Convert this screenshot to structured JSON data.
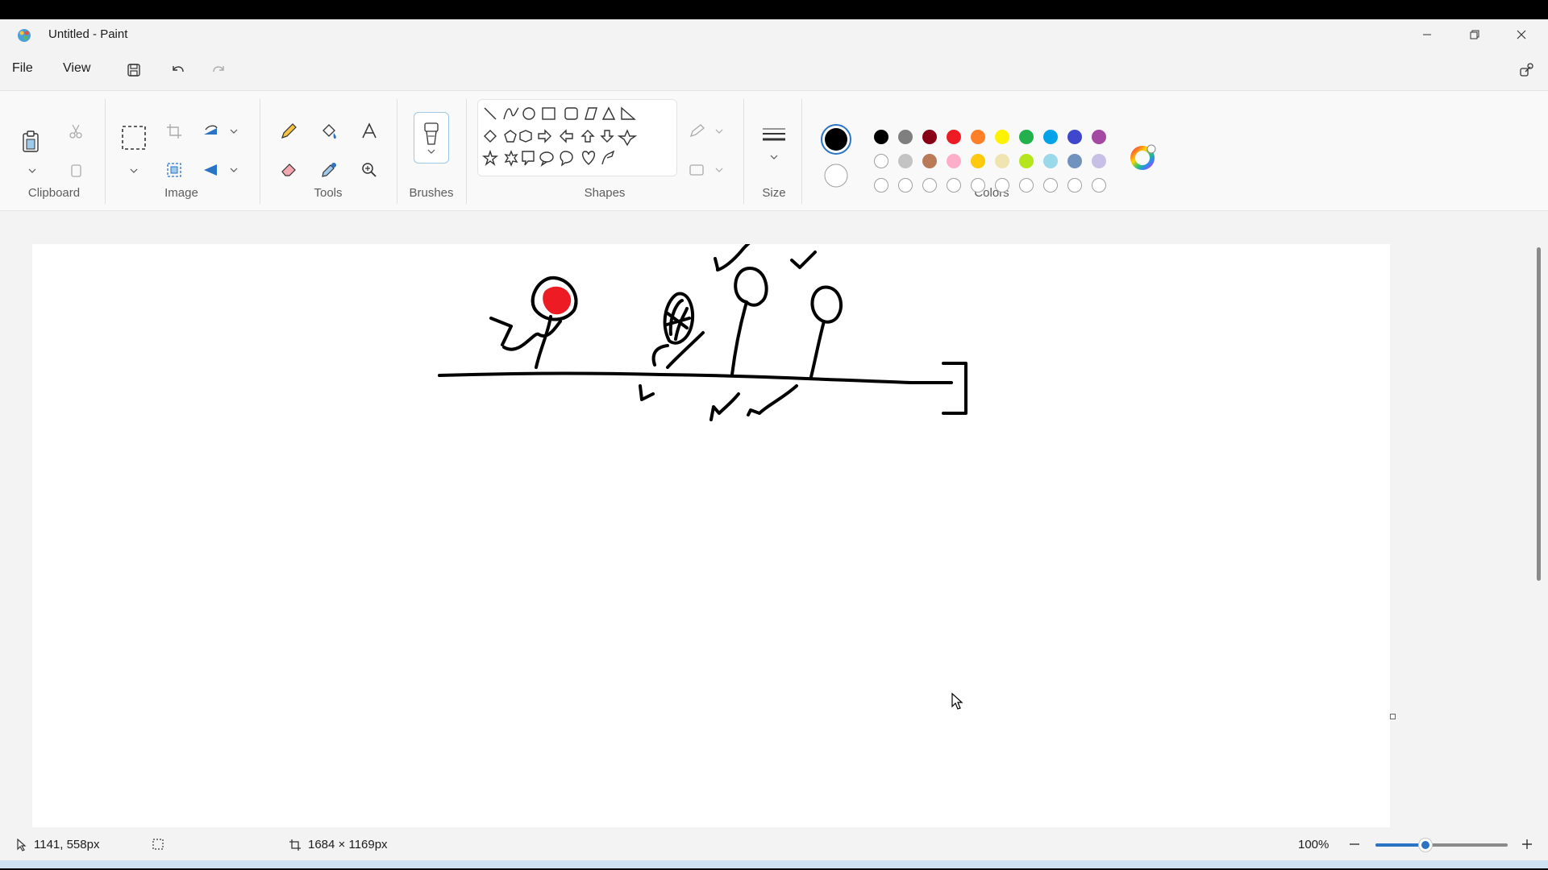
{
  "window": {
    "title": "Untitled - Paint"
  },
  "menu": {
    "file": "File",
    "view": "View"
  },
  "ribbon": {
    "groups": {
      "clipboard": "Clipboard",
      "image": "Image",
      "tools": "Tools",
      "brushes": "Brushes",
      "shapes": "Shapes",
      "size": "Size",
      "colors": "Colors"
    }
  },
  "colors": {
    "primary": "#000000",
    "secondary": "#ffffff",
    "palette_row1": [
      "#000000",
      "#7f7f7f",
      "#880015",
      "#ed1c24",
      "#ff7f27",
      "#fff200",
      "#22b14c",
      "#00a2e8",
      "#3f48cc",
      "#a349a4"
    ],
    "palette_row2": [
      "#ffffff",
      "#c3c3c3",
      "#b97a57",
      "#ffaec9",
      "#ffc90e",
      "#efe4b0",
      "#b5e61d",
      "#99d9ea",
      "#7092be",
      "#c8bfe7"
    ],
    "palette_row3_empty_count": 10
  },
  "status": {
    "cursor_position": "1141, 558px",
    "canvas_size": "1684 × 1169px",
    "zoom": "100%",
    "zoom_fraction": 0.38
  }
}
